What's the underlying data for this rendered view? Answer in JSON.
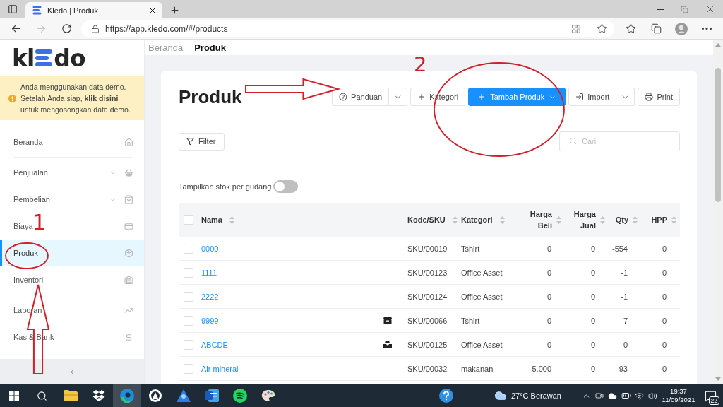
{
  "browser": {
    "tab": {
      "title": "Kledo | Produk",
      "selected": true
    },
    "url": "https://app.kledo.com/#/products",
    "forward_disabled": true
  },
  "sidebar": {
    "logo": {
      "left": "kl",
      "right": "do"
    },
    "notice": {
      "before": "Anda menggunakan data demo. Setelah Anda siap,",
      "link": "klik disini",
      "after": "untuk mengosongkan data demo."
    },
    "groups": [
      {
        "items": [
          {
            "label": "Beranda",
            "expandable": false,
            "selected": false
          }
        ]
      },
      {
        "items": [
          {
            "label": "Penjualan",
            "expandable": true,
            "selected": false
          },
          {
            "label": "Pembelian",
            "expandable": true,
            "selected": false
          },
          {
            "label": "Biaya",
            "expandable": false,
            "selected": false
          },
          {
            "label": "Produk",
            "expandable": false,
            "selected": true
          },
          {
            "label": "Inventori",
            "expandable": false,
            "selected": false
          }
        ]
      },
      {
        "items": [
          {
            "label": "Laporan",
            "expandable": false,
            "selected": false
          },
          {
            "label": "Kas & Bank",
            "expandable": false,
            "selected": false
          }
        ]
      }
    ]
  },
  "breadcrumb": [
    {
      "label": "Beranda",
      "current": false
    },
    {
      "label": "Produk",
      "current": true
    }
  ],
  "page": {
    "title": "Produk",
    "actions": [
      {
        "kind": "split",
        "label": "Panduan"
      },
      {
        "kind": "plain",
        "label": "Kategori"
      },
      {
        "kind": "primary",
        "label": "Tambah Produk"
      },
      {
        "kind": "split",
        "label": "Import"
      },
      {
        "kind": "plain",
        "label": "Print"
      }
    ],
    "filter_button": "Filter",
    "search": {
      "placeholder": "Cari"
    },
    "stock_toggle": {
      "label": "Tampilkan stok per gudang",
      "on": false
    }
  },
  "table": {
    "select_all": {
      "checked": false
    },
    "columns": [
      {
        "label": "Nama",
        "kind": "text"
      },
      {
        "label": "Kode/SKU",
        "kind": "text"
      },
      {
        "label": "Kategori",
        "kind": "text"
      },
      {
        "label": "Harga Beli",
        "kind": "number"
      },
      {
        "label": "Harga Jual",
        "kind": "number"
      },
      {
        "label": "Qty",
        "kind": "number"
      },
      {
        "label": "HPP",
        "kind": "number"
      }
    ],
    "rows": [
      {
        "checked": false,
        "kind": "plain",
        "cells": [
          "0000",
          "SKU/00019",
          "Tshirt",
          "0",
          "0",
          "-554",
          "0"
        ]
      },
      {
        "checked": false,
        "kind": "plain",
        "cells": [
          "1111",
          "SKU/00123",
          "Office Asset",
          "0",
          "0",
          "-1",
          "0"
        ]
      },
      {
        "checked": false,
        "kind": "plain",
        "cells": [
          "2222",
          "SKU/00124",
          "Office Asset",
          "0",
          "0",
          "-1",
          "0"
        ]
      },
      {
        "checked": false,
        "kind": "box",
        "cells": [
          "9999",
          "SKU/00066",
          "Tshirt",
          "0",
          "0",
          "-7",
          "0"
        ]
      },
      {
        "checked": false,
        "kind": "tray",
        "cells": [
          "ABCDE",
          "SKU/00125",
          "Office Asset",
          "0",
          "0",
          "0",
          "0"
        ]
      },
      {
        "checked": false,
        "kind": "plain",
        "cells": [
          "Air mineral",
          "SKU/00032",
          "makanan",
          "5.000",
          "0",
          "-93",
          "0"
        ]
      }
    ]
  },
  "taskbar": {
    "apps": [
      {
        "selected": false
      },
      {
        "selected": false
      },
      {
        "selected": true
      },
      {
        "selected": false
      },
      {
        "selected": false
      },
      {
        "selected": false
      },
      {
        "selected": false
      },
      {
        "selected": false
      }
    ],
    "weather": "27°C Berawan",
    "time": "19:37",
    "date": "11/09/2021",
    "notifications": "22"
  },
  "annotations": [
    {
      "kind": "arrow-right"
    },
    {
      "kind": "label",
      "text": "2"
    },
    {
      "kind": "ellipse"
    },
    {
      "kind": "label",
      "text": "1"
    },
    {
      "kind": "ellipse"
    },
    {
      "kind": "arrow-up"
    }
  ]
}
